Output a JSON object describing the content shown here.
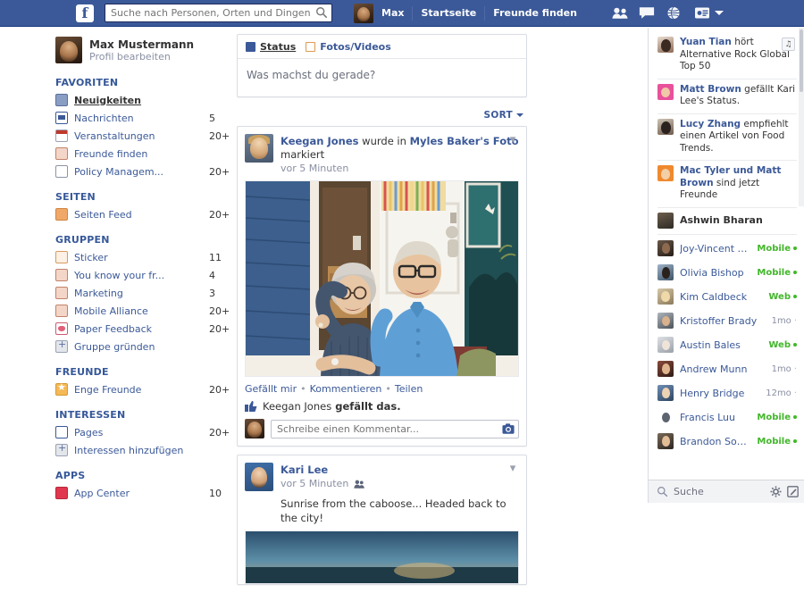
{
  "topbar": {
    "logo": "f",
    "logo_icon": "facebook-logo",
    "search_placeholder": "Suche nach Personen, Orten und Dingen",
    "search_value": "",
    "search_icon": "search-icon",
    "account_name": "Max",
    "home_label": "Startseite",
    "find_friends_label": "Freunde finden",
    "icons": [
      "friend-requests-icon",
      "messages-icon",
      "notifications-globe-icon",
      "privacy-lock-icon",
      "chevron-down-icon"
    ]
  },
  "sidebar": {
    "profile": {
      "name": "Max Mustermann",
      "edit_label": "Profil bearbeiten",
      "avatar": "user-avatar"
    },
    "sections": [
      {
        "title": "FAVORITEN",
        "items": [
          {
            "label": "Neuigkeiten",
            "count": "",
            "icon": "news-feed-icon",
            "icon_class": "ico-news",
            "active": true
          },
          {
            "label": "Nachrichten",
            "count": "5",
            "icon": "messages-icon",
            "icon_class": "ico-msg",
            "active": false
          },
          {
            "label": "Veranstaltungen",
            "count": "20+",
            "icon": "events-calendar-icon",
            "icon_class": "ico-event",
            "active": false
          },
          {
            "label": "Freunde finden",
            "count": "",
            "icon": "find-friends-icon",
            "icon_class": "ico-friends",
            "active": false
          },
          {
            "label": "Policy Managem...",
            "count": "20+",
            "icon": "policy-icon",
            "icon_class": "ico-policy",
            "active": false
          }
        ]
      },
      {
        "title": "SEITEN",
        "items": [
          {
            "label": "Seiten Feed",
            "count": "20+",
            "icon": "pages-feed-icon",
            "icon_class": "ico-pages",
            "active": false
          }
        ]
      },
      {
        "title": "GRUPPEN",
        "items": [
          {
            "label": "Sticker",
            "count": "11",
            "icon": "sticker-icon",
            "icon_class": "ico-sticker",
            "active": false
          },
          {
            "label": "You know your fr...",
            "count": "4",
            "icon": "group-icon",
            "icon_class": "ico-group",
            "active": false
          },
          {
            "label": "Marketing",
            "count": "3",
            "icon": "group-icon",
            "icon_class": "ico-group",
            "active": false
          },
          {
            "label": "Mobile Alliance",
            "count": "20+",
            "icon": "group-icon",
            "icon_class": "ico-group",
            "active": false
          },
          {
            "label": "Paper Feedback",
            "count": "20+",
            "icon": "heart-icon",
            "icon_class": "ico-heart",
            "active": false
          },
          {
            "label": "Gruppe gründen",
            "count": "",
            "icon": "plus-circle-icon",
            "icon_class": "ico-plus",
            "active": false
          }
        ]
      },
      {
        "title": "FREUNDE",
        "items": [
          {
            "label": "Enge Freunde",
            "count": "20+",
            "icon": "star-icon",
            "icon_class": "ico-star",
            "active": false
          }
        ]
      },
      {
        "title": "INTERESSEN",
        "items": [
          {
            "label": "Pages",
            "count": "20+",
            "icon": "pages-icon",
            "icon_class": "ico-pagesblue",
            "active": false
          },
          {
            "label": "Interessen hinzufügen",
            "count": "",
            "icon": "plus-circle-icon",
            "icon_class": "ico-plus",
            "active": false
          }
        ]
      },
      {
        "title": "APPS",
        "items": [
          {
            "label": "App Center",
            "count": "10",
            "icon": "app-center-icon",
            "icon_class": "ico-app",
            "active": false
          }
        ]
      }
    ]
  },
  "composer": {
    "status_tab": "Status",
    "photo_tab": "Fotos/Videos",
    "placeholder": "Was machst du gerade?",
    "sort_label": "SORT"
  },
  "feed": {
    "posts": [
      {
        "author": "Keegan Jones",
        "action_mid": " wurde in ",
        "target": "Myles Baker's Foto",
        "action_end": " markiert",
        "time": "vor 5 Minuten",
        "avatar": "keegan-jones-avatar",
        "photo_alt": "elderly-couple-on-porch-photo",
        "actions": {
          "like": "Gefällt mir",
          "comment": "Kommentieren",
          "share": "Teilen"
        },
        "like_text_name": "Keegan Jones",
        "like_text_rest": " gefällt das.",
        "comment_placeholder": "Schreibe einen Kommentar..."
      },
      {
        "author": "Kari Lee",
        "time": "vor 5 Minuten",
        "avatar": "kari-lee-avatar",
        "text": "Sunrise from the caboose... Headed back to the city!",
        "audience_icon": "friends-audience-icon"
      }
    ]
  },
  "ticker": {
    "stories": [
      {
        "name": "Yuan Tian",
        "text": " hört Alternative Rock Global Top 50",
        "avatar_class": "av-yuan",
        "badge": "♫",
        "badge_icon": "music-note-icon"
      },
      {
        "name": "Matt Brown",
        "text": " gefällt Kari Lee's Status.",
        "avatar_class": "av-matt",
        "badge": "",
        "badge_icon": ""
      },
      {
        "name": "Lucy Zhang",
        "text": " empfiehlt einen Artikel von Food Trends.",
        "avatar_class": "av-lucy",
        "badge": "",
        "badge_icon": ""
      },
      {
        "name": "Mac Tyler und Matt Brown",
        "text": " sind jetzt Freunde",
        "avatar_class": "av-mac",
        "badge": "",
        "badge_icon": ""
      }
    ],
    "last_story_name": "Ashwin Bharan"
  },
  "chat": {
    "friends": [
      {
        "name": "Joy-Vincent Nie...",
        "status": "Mobile",
        "online": true,
        "avatar_class": "ca1"
      },
      {
        "name": "Olivia Bishop",
        "status": "Mobile",
        "online": true,
        "avatar_class": "ca2"
      },
      {
        "name": "Kim Caldbeck",
        "status": "Web",
        "online": true,
        "avatar_class": "ca3"
      },
      {
        "name": "Kristoffer Brady",
        "status": "1mo",
        "online": false,
        "avatar_class": "ca4"
      },
      {
        "name": "Austin Bales",
        "status": "Web",
        "online": true,
        "avatar_class": "ca5"
      },
      {
        "name": "Andrew Munn",
        "status": "1mo",
        "online": false,
        "avatar_class": "ca6"
      },
      {
        "name": "Henry Bridge",
        "status": "12mo",
        "online": false,
        "avatar_class": "ca7"
      },
      {
        "name": "Francis Luu",
        "status": "Mobile",
        "online": true,
        "avatar_class": "ca8"
      },
      {
        "name": "Brandon Souba",
        "status": "Mobile",
        "online": true,
        "avatar_class": "ca9"
      }
    ],
    "search_label": "Suche",
    "search_icon": "search-icon",
    "gear_icon": "gear-icon",
    "compose_icon": "compose-icon"
  },
  "colors": {
    "chrome_blue": "#3b5998",
    "link_blue": "#365899",
    "online_green": "#42b72a",
    "muted_gray": "#8a8fa3"
  }
}
